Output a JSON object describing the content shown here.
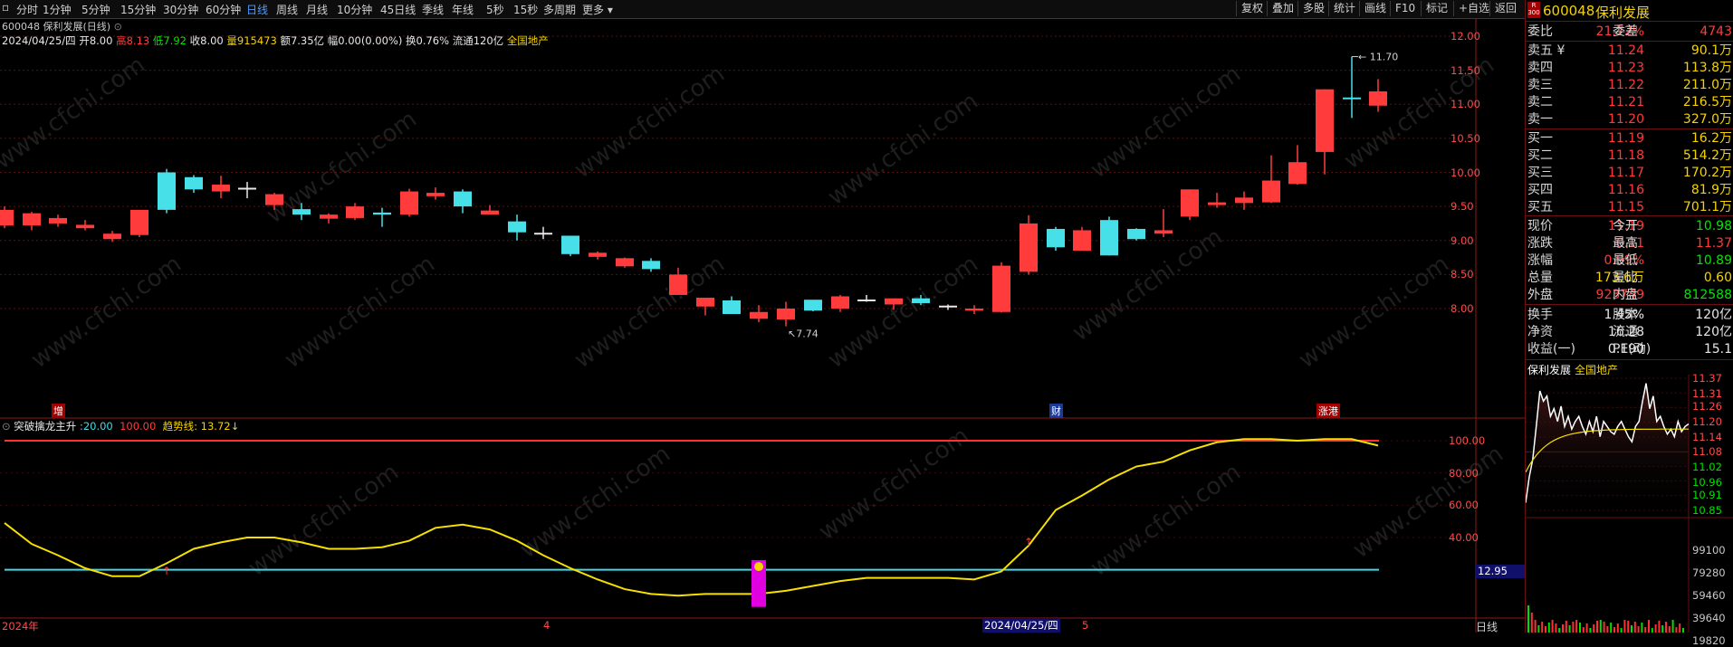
{
  "toolbar": {
    "items": [
      "分时",
      "1分钟",
      "5分钟",
      "15分钟",
      "30分钟",
      "60分钟",
      "日线",
      "周线",
      "月线",
      "10分钟",
      "45日线",
      "季线",
      "年线",
      "5秒",
      "15秒",
      "多周期",
      "更多"
    ],
    "active": "日线",
    "right_items": [
      "复权",
      "叠加",
      "多股",
      "统计",
      "画线",
      "F10",
      "标记",
      "+自选",
      "返回"
    ]
  },
  "chart": {
    "title": "600048 保利发展(日线)",
    "date": "2024/04/25/四",
    "open_label": "开",
    "open": "8.00",
    "high_label": "高",
    "high": "8.13",
    "low_label": "低",
    "low": "7.92",
    "close_label": "收",
    "close": "8.00",
    "volume_label": "量",
    "volume": "915473",
    "amount_label": "额",
    "amount": "7.35亿",
    "change_label": "幅",
    "change": "0.00(0.00%)",
    "turnover_label": "换",
    "turnover": "0.76%",
    "float_label": "流通",
    "float": "120亿",
    "sector": "全国地产",
    "max_label": "11.70",
    "min_label": "7.74",
    "price_ticks": [
      "12.00",
      "11.50",
      "11.00",
      "10.50",
      "10.00",
      "9.50",
      "9.00",
      "8.50",
      "8.00"
    ],
    "markers": [
      "增",
      "财",
      "涨港"
    ]
  },
  "indicator": {
    "name": "突破擒龙主升",
    "val1": "20.00",
    "val2": "100.00",
    "trend_label": "趋势线:",
    "trend_value": "13.72↓",
    "ticks": [
      "100.00",
      "80.00",
      "60.00",
      "40.00"
    ],
    "current": "12.95"
  },
  "x_axis": {
    "labels": [
      "2024年",
      "4",
      "2024/04/25/四",
      "5"
    ],
    "period": "日线"
  },
  "quote": {
    "code": "600048",
    "name": "保利发展",
    "badge_top": "R",
    "badge_bot": "300",
    "weibi_label": "委比",
    "weibi": "21.72%",
    "weicha_label": "委差",
    "weicha": "4743",
    "asks": [
      {
        "label": "卖五",
        "flag": "¥",
        "price": "11.24",
        "vol": "90.1万"
      },
      {
        "label": "卖四",
        "flag": "",
        "price": "11.23",
        "vol": "113.8万"
      },
      {
        "label": "卖三",
        "flag": "",
        "price": "11.22",
        "vol": "211.0万"
      },
      {
        "label": "卖二",
        "flag": "",
        "price": "11.21",
        "vol": "216.5万"
      },
      {
        "label": "卖一",
        "flag": "",
        "price": "11.20",
        "vol": "327.0万"
      }
    ],
    "bids": [
      {
        "label": "买一",
        "price": "11.19",
        "vol": "16.2万"
      },
      {
        "label": "买二",
        "price": "11.18",
        "vol": "514.2万"
      },
      {
        "label": "买三",
        "price": "11.17",
        "vol": "170.2万"
      },
      {
        "label": "买四",
        "price": "11.16",
        "vol": "81.9万"
      },
      {
        "label": "买五",
        "price": "11.15",
        "vol": "701.1万"
      }
    ],
    "stats": [
      {
        "l1": "现价",
        "v1": "11.19",
        "c1": "red",
        "l2": "今开",
        "v2": "10.98",
        "c2": "green"
      },
      {
        "l1": "涨跌",
        "v1": "0.11",
        "c1": "red",
        "l2": "最高",
        "v2": "11.37",
        "c2": "red"
      },
      {
        "l1": "涨幅",
        "v1": "0.99%",
        "c1": "red",
        "l2": "最低",
        "v2": "10.89",
        "c2": "green"
      },
      {
        "l1": "总量",
        "v1": "173.6万",
        "c1": "yellow",
        "l2": "量比",
        "v2": "0.60",
        "c2": "yellow"
      },
      {
        "l1": "外盘",
        "v1": "923749",
        "c1": "red",
        "l2": "内盘",
        "v2": "812588",
        "c2": "green"
      }
    ],
    "stats2": [
      {
        "l1": "换手",
        "v1": "1.45%",
        "l2": "股本",
        "v2": "120亿"
      },
      {
        "l1": "净资",
        "v1": "16.28",
        "l2": "流通",
        "v2": "120亿"
      },
      {
        "l1": "收益(一)",
        "v1": "0.190",
        "l2": "PE(动)",
        "v2": "15.1"
      }
    ],
    "mini_title": "保利发展",
    "mini_sector": "全国地产",
    "mini_price_ticks": [
      "11.37",
      "11.31",
      "11.26",
      "11.20",
      "11.14",
      "11.08",
      "11.02",
      "10.96",
      "10.91",
      "10.85"
    ],
    "mini_vol_ticks": [
      "99100",
      "79280",
      "59460",
      "39640",
      "19820"
    ]
  },
  "watermark": "www.cfchi.com",
  "colors": {
    "up": "#ff3b3b",
    "down": "#48e0e8",
    "ma": "#f5e000",
    "accent": "#4e9bff"
  }
}
